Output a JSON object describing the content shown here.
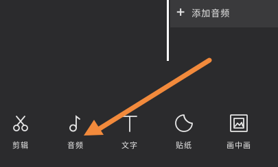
{
  "timeline": {
    "add_audio_label": "添加音频",
    "add_icon": "plus-icon"
  },
  "toolbar": {
    "items": [
      {
        "label": "剪辑",
        "icon": "scissors-icon"
      },
      {
        "label": "音频",
        "icon": "music-note-icon"
      },
      {
        "label": "文字",
        "icon": "text-icon"
      },
      {
        "label": "贴纸",
        "icon": "sticker-icon"
      },
      {
        "label": "画中画",
        "icon": "picture-in-picture-icon"
      }
    ]
  },
  "annotation": {
    "arrow_color": "#f28a3c",
    "target": "音频"
  },
  "colors": {
    "background": "#2b2b2d",
    "track": "#3a3a3c",
    "playhead": "#ffffff"
  }
}
